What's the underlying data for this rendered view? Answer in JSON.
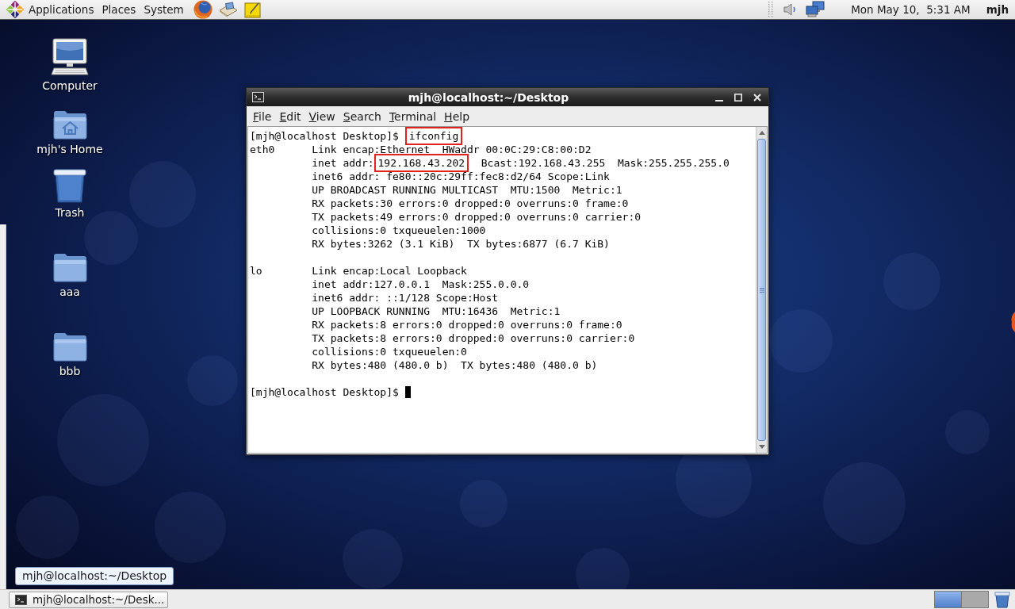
{
  "top_panel": {
    "menus": [
      "Applications",
      "Places",
      "System"
    ],
    "clock": "Mon May 10,  5:31 AM",
    "user": "mjh"
  },
  "desktop_icons": [
    {
      "kind": "computer",
      "label": "Computer"
    },
    {
      "kind": "home",
      "label": "mjh's Home"
    },
    {
      "kind": "trash",
      "label": "Trash"
    },
    {
      "kind": "folder",
      "label": "aaa"
    },
    {
      "kind": "folder",
      "label": "bbb"
    }
  ],
  "terminal": {
    "title": "mjh@localhost:~/Desktop",
    "menu": [
      "File",
      "Edit",
      "View",
      "Search",
      "Terminal",
      "Help"
    ],
    "output": [
      {
        "kind": "command",
        "prompt": "[mjh@localhost Desktop]$",
        "parts": [
          {
            "text": "ifconfig",
            "highlighted": true
          }
        ]
      },
      {
        "kind": "interface",
        "name": "eth0",
        "lines": [
          {
            "parts": [
              {
                "text": "Link encap:Ethernet  HWaddr 00:0C:29:C8:00:D2",
                "highlighted": false
              }
            ]
          },
          {
            "parts": [
              {
                "text": "inet addr:",
                "highlighted": false
              },
              {
                "text": "192.168.43.202",
                "highlighted": true
              },
              {
                "text": "  Bcast:192.168.43.255  Mask:255.255.255.0",
                "highlighted": false
              }
            ]
          },
          {
            "parts": [
              {
                "text": "inet6 addr: fe80::20c:29ff:fec8:d2/64 Scope:Link",
                "highlighted": false
              }
            ]
          },
          {
            "parts": [
              {
                "text": "UP BROADCAST RUNNING MULTICAST  MTU:1500  Metric:1",
                "highlighted": false
              }
            ]
          },
          {
            "parts": [
              {
                "text": "RX packets:30 errors:0 dropped:0 overruns:0 frame:0",
                "highlighted": false
              }
            ]
          },
          {
            "parts": [
              {
                "text": "TX packets:49 errors:0 dropped:0 overruns:0 carrier:0",
                "highlighted": false
              }
            ]
          },
          {
            "parts": [
              {
                "text": "collisions:0 txqueuelen:1000",
                "highlighted": false
              }
            ]
          },
          {
            "parts": [
              {
                "text": "RX bytes:3262 (3.1 KiB)  TX bytes:6877 (6.7 KiB)",
                "highlighted": false
              }
            ]
          }
        ]
      },
      {
        "kind": "interface",
        "name": "lo",
        "lines": [
          {
            "parts": [
              {
                "text": "Link encap:Local Loopback",
                "highlighted": false
              }
            ]
          },
          {
            "parts": [
              {
                "text": "inet addr:127.0.0.1  Mask:255.0.0.0",
                "highlighted": false
              }
            ]
          },
          {
            "parts": [
              {
                "text": "inet6 addr: ::1/128 Scope:Host",
                "highlighted": false
              }
            ]
          },
          {
            "parts": [
              {
                "text": "UP LOOPBACK RUNNING  MTU:16436  Metric:1",
                "highlighted": false
              }
            ]
          },
          {
            "parts": [
              {
                "text": "RX packets:8 errors:0 dropped:0 overruns:0 frame:0",
                "highlighted": false
              }
            ]
          },
          {
            "parts": [
              {
                "text": "TX packets:8 errors:0 dropped:0 overruns:0 carrier:0",
                "highlighted": false
              }
            ]
          },
          {
            "parts": [
              {
                "text": "collisions:0 txqueuelen:0",
                "highlighted": false
              }
            ]
          },
          {
            "parts": [
              {
                "text": "RX bytes:480 (480.0 b)  TX bytes:480 (480.0 b)",
                "highlighted": false
              }
            ]
          }
        ]
      },
      {
        "kind": "prompt",
        "prompt": "[mjh@localhost Desktop]$",
        "cursor": true
      }
    ]
  },
  "tooltip": "mjh@localhost:~/Desktop",
  "taskbar": {
    "tasks": [
      {
        "label": "mjh@localhost:~/Desk..."
      }
    ],
    "workspaces": [
      {
        "selected": true
      },
      {
        "selected": false
      }
    ]
  }
}
